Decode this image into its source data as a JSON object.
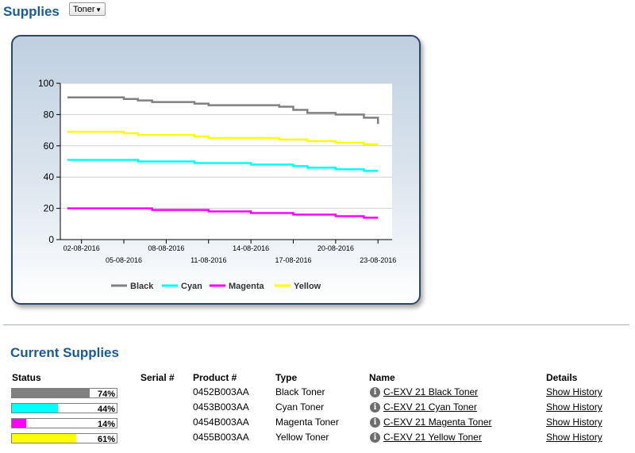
{
  "header": {
    "title": "Supplies",
    "select_value": "Toner"
  },
  "chart_data": {
    "type": "line",
    "y_ticks": [
      "0",
      "20",
      "40",
      "60",
      "80",
      "100"
    ],
    "ylim": [
      0,
      100
    ],
    "x_ticks_upper": [
      "02-08-2016",
      "08-08-2016",
      "14-08-2016",
      "20-08-2016"
    ],
    "x_ticks_lower": [
      "05-08-2016",
      "11-08-2016",
      "17-08-2016",
      "23-08-2016"
    ],
    "x_dates": [
      "01-08-2016",
      "05-08-2016",
      "06-08-2016",
      "07-08-2016",
      "10-08-2016",
      "11-08-2016",
      "14-08-2016",
      "16-08-2016",
      "17-08-2016",
      "18-08-2016",
      "20-08-2016",
      "22-08-2016",
      "23-08-2016"
    ],
    "series": [
      {
        "name": "Black",
        "color": "#808080",
        "values": [
          91,
          90,
          89,
          88,
          87,
          86,
          86,
          85,
          83,
          81,
          80,
          78,
          74
        ]
      },
      {
        "name": "Cyan",
        "color": "#00ffff",
        "values": [
          51,
          51,
          50,
          50,
          49,
          49,
          48,
          48,
          47,
          46,
          45,
          44,
          44
        ]
      },
      {
        "name": "Magenta",
        "color": "#ff00ff",
        "values": [
          20,
          20,
          20,
          19,
          19,
          18,
          17,
          17,
          16,
          16,
          15,
          14,
          14
        ]
      },
      {
        "name": "Yellow",
        "color": "#ffff00",
        "values": [
          69,
          68,
          67,
          67,
          66,
          65,
          65,
          64,
          64,
          63,
          62,
          61,
          61
        ]
      }
    ]
  },
  "current_supplies": {
    "title": "Current Supplies",
    "headers": {
      "status": "Status",
      "serial": "Serial #",
      "product": "Product #",
      "type": "Type",
      "name": "Name",
      "details": "Details"
    },
    "rows": [
      {
        "level": 74,
        "level_label": "74%",
        "color": "#808080",
        "serial": "",
        "product": "0452B003AA",
        "type": "Black Toner",
        "name": "C-EXV 21 Black Toner",
        "details": "Show History"
      },
      {
        "level": 44,
        "level_label": "44%",
        "color": "#00ffff",
        "serial": "",
        "product": "0453B003AA",
        "type": "Cyan Toner",
        "name": "C-EXV 21 Cyan Toner",
        "details": "Show History"
      },
      {
        "level": 14,
        "level_label": "14%",
        "color": "#ff00ff",
        "serial": "",
        "product": "0454B003AA",
        "type": "Magenta Toner",
        "name": "C-EXV 21 Magenta Toner",
        "details": "Show History"
      },
      {
        "level": 61,
        "level_label": "61%",
        "color": "#ffff00",
        "serial": "",
        "product": "0455B003AA",
        "type": "Yellow Toner",
        "name": "C-EXV 21 Yellow Toner",
        "details": "Show History"
      }
    ],
    "info_icon": "info-icon"
  }
}
